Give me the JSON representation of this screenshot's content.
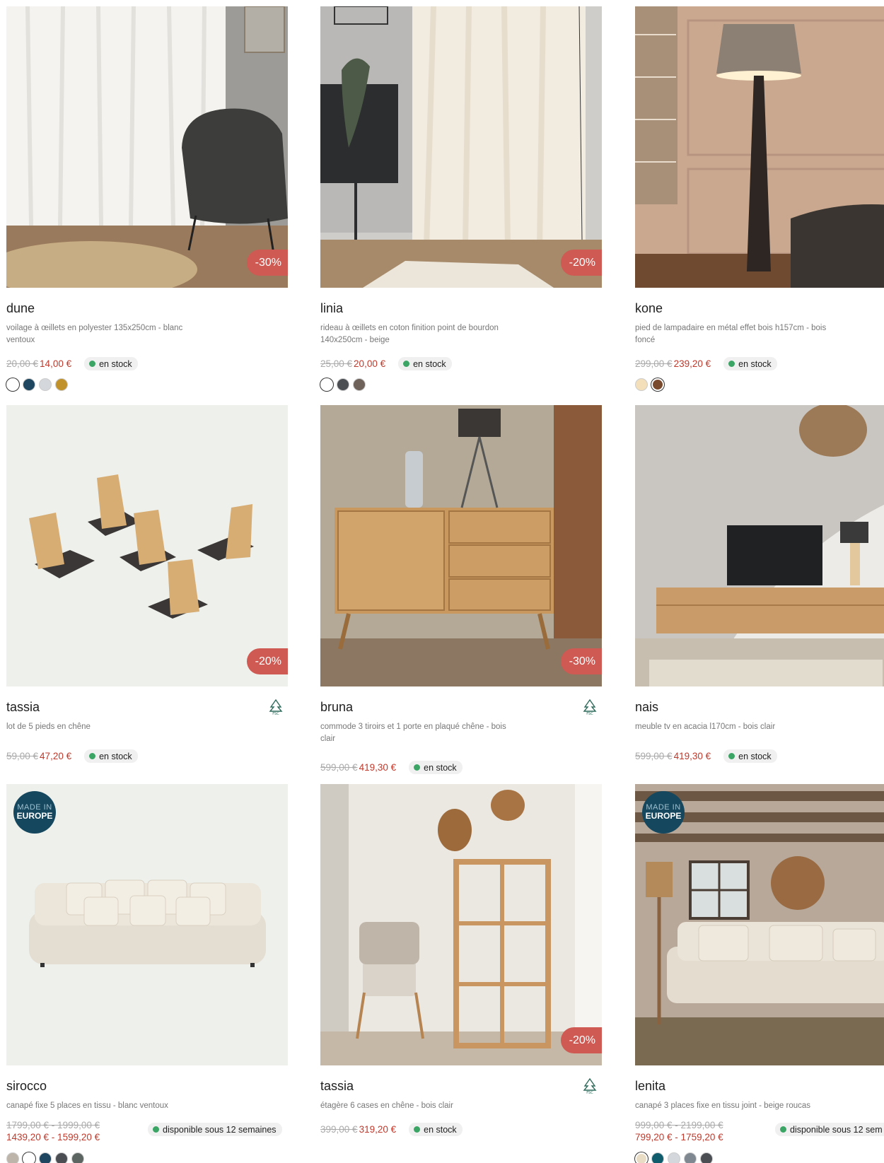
{
  "products": [
    {
      "name": "dune",
      "desc": "voilage à œillets en polyester 135x250cm - blanc ventoux",
      "old_price": "20,00 €",
      "new_price": "14,00 €",
      "stock": "en stock",
      "discount": "-30%",
      "swatches": [
        "#ffffff",
        "#1e4660",
        "#d4d8dc",
        "#c2922a"
      ]
    },
    {
      "name": "linia",
      "desc": "rideau à œillets en coton finition point de bourdon 140x250cm - beige",
      "old_price": "25,00 €",
      "new_price": "20,00 €",
      "stock": "en stock",
      "discount": "-20%",
      "swatches": [
        "#ffffff",
        "#4b4f54",
        "#6e625a"
      ]
    },
    {
      "name": "kone",
      "desc": "pied de lampadaire en métal effet bois h157cm - bois foncé",
      "old_price": "299,00 €",
      "new_price": "239,20 €",
      "stock": "en stock",
      "discount": "",
      "swatches": [
        "#f3dfb9",
        "#7a4a2e"
      ]
    },
    {
      "name": "tassia",
      "desc": "lot de 5 pieds en chêne",
      "old_price": "59,00 €",
      "new_price": "47,20 €",
      "stock": "en stock",
      "discount": "-20%",
      "swatches": []
    },
    {
      "name": "bruna",
      "desc": "commode 3 tiroirs et 1 porte en plaqué chêne - bois clair",
      "old_price": "599,00 €",
      "new_price": "419,30 €",
      "stock": "en stock",
      "discount": "-30%",
      "swatches": []
    },
    {
      "name": "nais",
      "desc": "meuble tv en acacia l170cm - bois clair",
      "old_price": "599,00 €",
      "new_price": "419,30 €",
      "stock": "en stock",
      "discount": "",
      "swatches": []
    },
    {
      "name": "sirocco",
      "desc": "canapé fixe 5 places en tissu - blanc ventoux",
      "old_price": "1799,00 € - 1999,00 €",
      "new_price": "1439,20 € - 1599,20 €",
      "stock": "disponible sous 12 semaines",
      "discount": "",
      "swatches": [
        "#bdb5aa",
        "#ffffff",
        "#1e4660",
        "#4b4f54",
        "#5d6563"
      ]
    },
    {
      "name": "tassia",
      "desc": "étagère 6 cases en chêne - bois clair",
      "old_price": "399,00 €",
      "new_price": "319,20 €",
      "stock": "en stock",
      "discount": "-20%",
      "swatches": []
    },
    {
      "name": "lenita",
      "desc": "canapé 3 places fixe en tissu joint - beige roucas",
      "old_price": "999,00 € - 2199,00 €",
      "new_price": "799,20 € - 1759,20 €",
      "stock": "disponible sous 12 sem",
      "discount": "",
      "swatches": [
        "#e9dcc4",
        "#0f5c6c",
        "#d4d8dc",
        "#7f8891",
        "#4b4f54"
      ]
    }
  ],
  "badges": {
    "made_in": "MADE IN",
    "europe": "EUROPE",
    "fsc": "FSC"
  }
}
